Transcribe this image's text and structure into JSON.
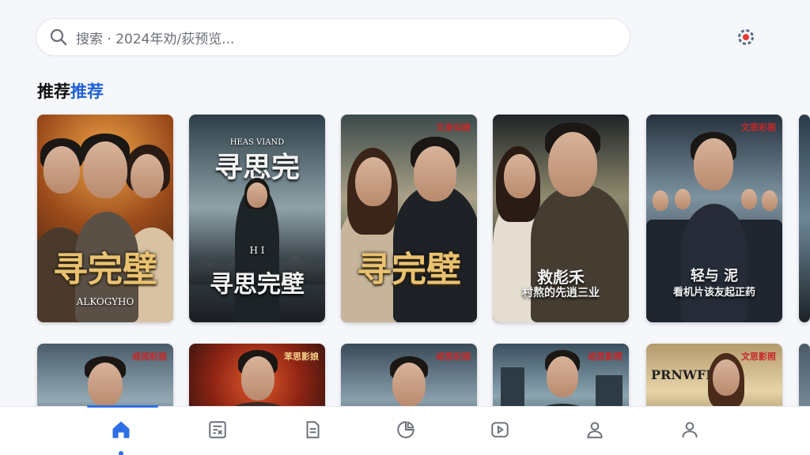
{
  "search": {
    "placeholder": "搜索 · 2024年劝/荻预览..."
  },
  "section": {
    "title_part1": "推荐",
    "title_part2": "推荐"
  },
  "posters_row1": [
    {
      "title": "寻完壁",
      "subtitle": "ALKOGYHO",
      "badge": ""
    },
    {
      "top_text": "HEAS VIAND",
      "title": "寻思完",
      "title2": "寻思完壁",
      "mid": "H I",
      "badge": ""
    },
    {
      "title": "寻完壁",
      "badge": "文身似娘"
    },
    {
      "title": "救彪禾",
      "subtitle": "村熬的先逍三业",
      "badge": ""
    },
    {
      "title": "轻与 泥",
      "subtitle": "看机片该友起正药",
      "badge": "文思彩振"
    }
  ],
  "posters_row2": [
    {
      "badge": "戒阅彩振"
    },
    {
      "badge": "苯思影娘"
    },
    {
      "badge": "戒思彩振"
    },
    {
      "badge": "戒思影照"
    },
    {
      "top_text": "PRNWFK",
      "badge": "文思影照"
    }
  ],
  "colors": {
    "accent": "#2f6fe4",
    "title_blue": "#1f5fd6",
    "badge_red": "#c62828"
  },
  "icons": {
    "search": "search-icon",
    "settings": "settings-icon",
    "nav": [
      "home-icon",
      "catalog-icon",
      "document-icon",
      "chart-icon",
      "play-icon",
      "user-icon",
      "profile-icon"
    ]
  }
}
